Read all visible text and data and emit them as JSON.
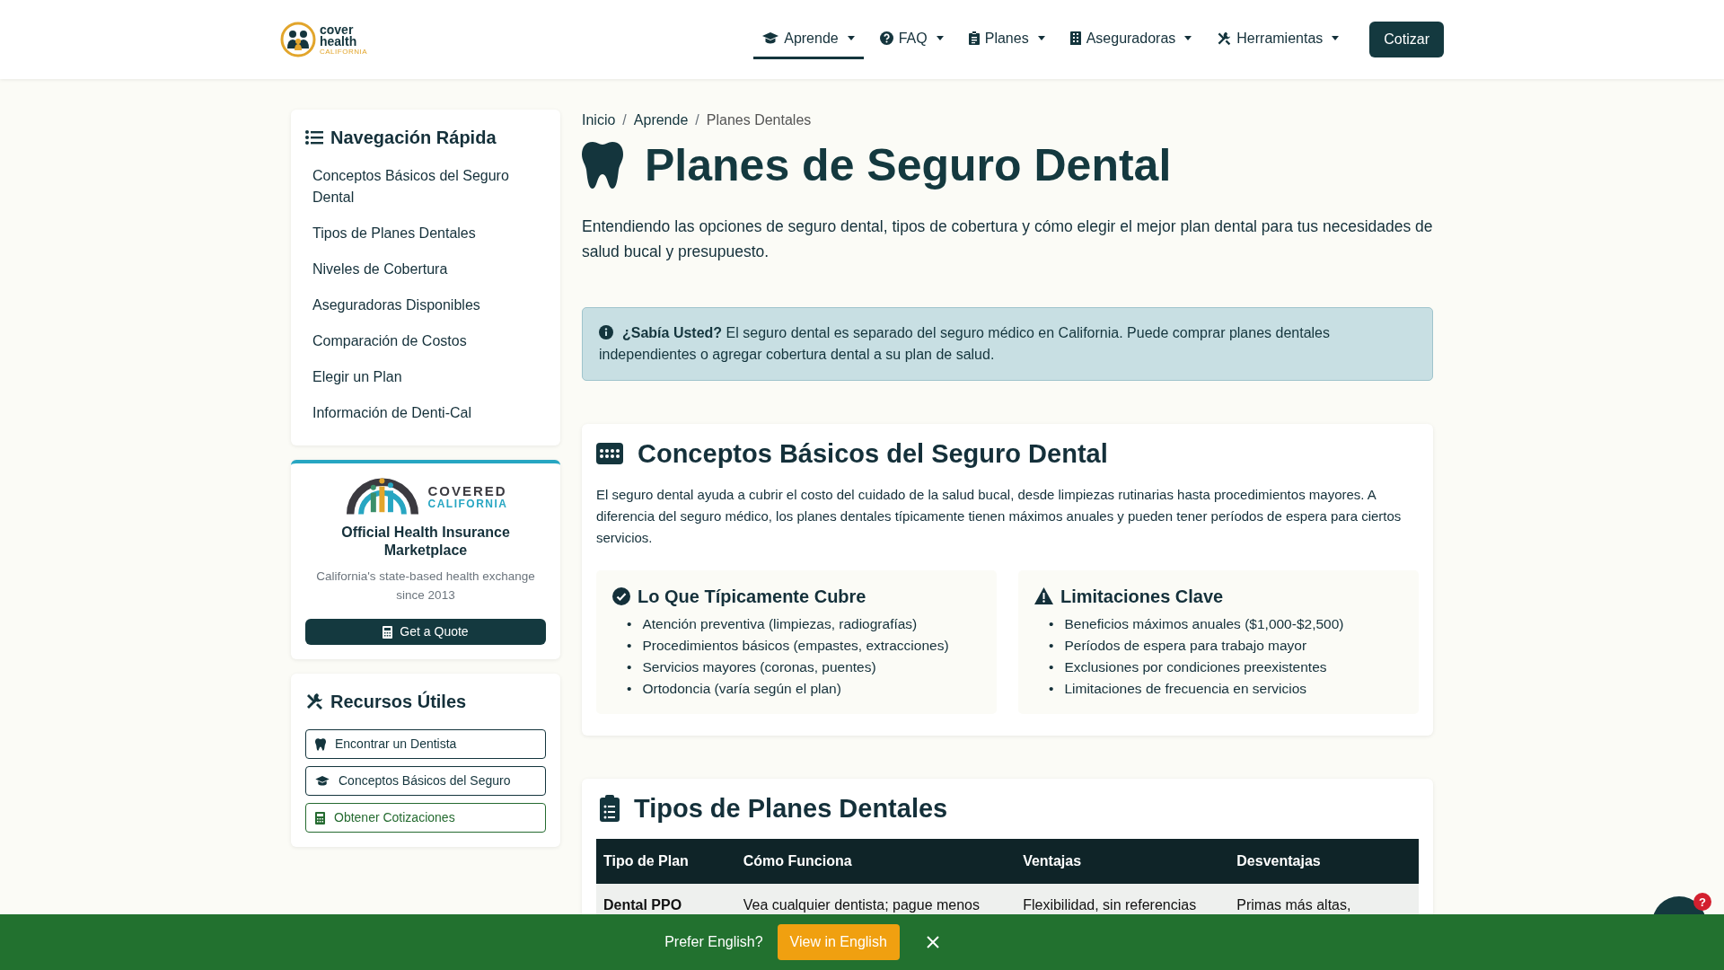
{
  "header": {
    "logo": {
      "line1": "cover",
      "line2": "health",
      "line3": "CALIFORNIA"
    },
    "nav": [
      {
        "label": "Aprende",
        "selected": true
      },
      {
        "label": "FAQ",
        "selected": false
      },
      {
        "label": "Planes",
        "selected": false
      },
      {
        "label": "Aseguradoras",
        "selected": false
      },
      {
        "label": "Herramientas",
        "selected": false
      }
    ],
    "cta": "Cotizar"
  },
  "sidebar": {
    "quick_nav": {
      "title": "Navegación Rápida",
      "items": [
        "Conceptos Básicos del Seguro Dental",
        "Tipos de Planes Dentales",
        "Niveles de Cobertura",
        "Aseguradoras Disponibles",
        "Comparación de Costos",
        "Elegir un Plan",
        "Información de Denti-Cal"
      ]
    },
    "marketplace": {
      "logo": {
        "line1": "COVERED",
        "line2": "CALIFORNIA"
      },
      "title": "Official Health Insurance Marketplace",
      "subtitle": "California's state-based health exchange since 2013",
      "button": "Get a Quote"
    },
    "resources": {
      "title": "Recursos Útiles",
      "links": [
        {
          "label": "Encontrar un Dentista",
          "kind": "primary"
        },
        {
          "label": "Conceptos Básicos del Seguro",
          "kind": "primary"
        },
        {
          "label": "Obtener Cotizaciones",
          "kind": "success"
        }
      ]
    }
  },
  "breadcrumb": [
    {
      "label": "Inicio",
      "selected": false
    },
    {
      "separator": "/",
      "label": "Aprende",
      "selected": false
    },
    {
      "separator": "/",
      "label": "Planes Dentales",
      "selected": true
    }
  ],
  "title": "Planes de Seguro Dental",
  "lead": "Entendiendo las opciones de seguro dental, tipos de cobertura y cómo elegir el mejor plan dental para tus necesidades de salud bucal y presupuesto.",
  "alert": "**¿Sabía Usted?** El seguro dental es separado del seguro médico en California. Puede comprar planes dentales independientes o agregar cobertura dental a su plan de salud.",
  "basics": {
    "title": "Conceptos Básicos del Seguro Dental",
    "text": "El seguro dental ayuda a cubrir el costo del cuidado de la salud bucal, desde limpiezas rutinarias hasta procedimientos mayores. A diferencia del seguro médico, los planes dentales típicamente tienen máximos anuales y pueden tener períodos de espera para ciertos servicios.",
    "boxes": [
      {
        "title": "Lo Que Típicamente Cubre",
        "items": [
          {
            "marker": "•",
            "text": "Atención preventiva (limpiezas, radiografías)"
          },
          {
            "marker": "•",
            "text": "Procedimientos básicos (empastes, extracciones)"
          },
          {
            "marker": "•",
            "text": "Servicios mayores (coronas, puentes)"
          },
          {
            "marker": "•",
            "text": "Ortodoncia (varía según el plan)"
          }
        ]
      },
      {
        "title": "Limitaciones Clave",
        "items": [
          {
            "marker": "•",
            "text": "Beneficios máximos anuales ($1,000-$2,500)"
          },
          {
            "marker": "•",
            "text": "Períodos de espera para trabajo mayor"
          },
          {
            "marker": "•",
            "text": "Exclusiones por condiciones preexistentes"
          },
          {
            "marker": "•",
            "text": "Limitaciones de frecuencia en servicios"
          }
        ]
      }
    ]
  },
  "plan_types": {
    "title": "Tipos de Planes Dentales",
    "columns": [
      "Tipo de Plan",
      "Cómo Funciona",
      "Ventajas",
      "Desventajas"
    ],
    "rows": [
      [
        "Dental PPO",
        "Vea cualquier dentista; pague menos",
        "Flexibilidad, sin referencias",
        "Primas más altas,"
      ]
    ]
  },
  "language_banner": {
    "prompt": "Prefer English?",
    "button": "View in English"
  },
  "chat_widget": {
    "badge": "?"
  }
}
